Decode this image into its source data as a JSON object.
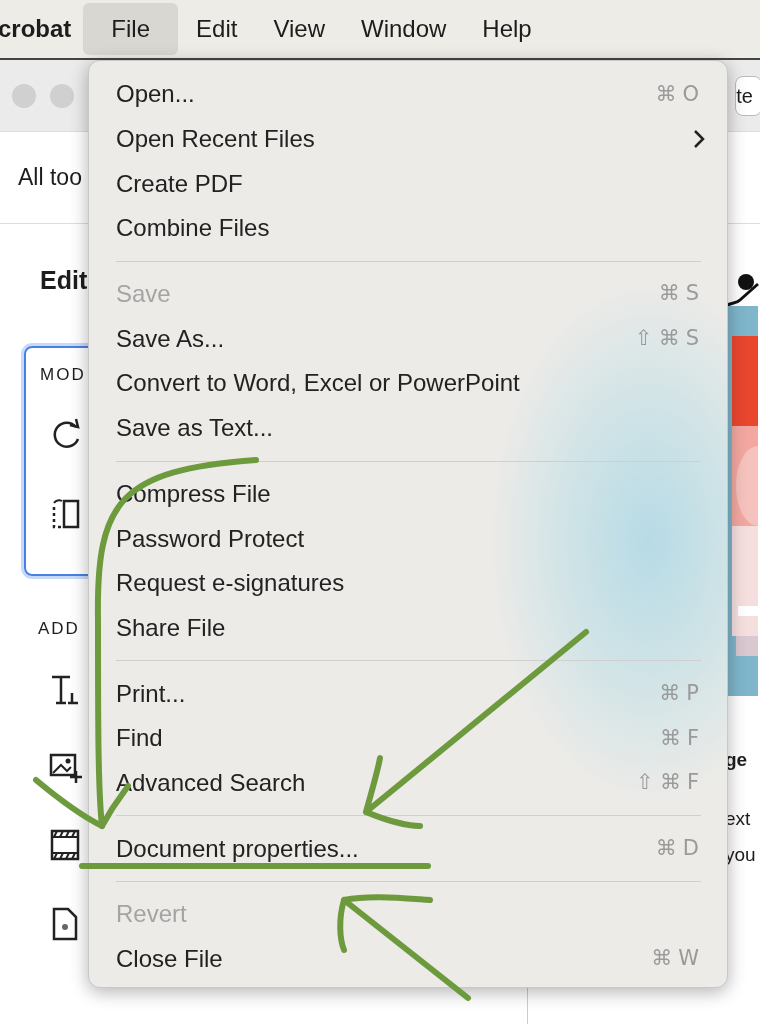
{
  "menu_bar": {
    "app_name": "crobat",
    "items": [
      {
        "label": "File",
        "selected": true
      },
      {
        "label": "Edit",
        "selected": false
      },
      {
        "label": "View",
        "selected": false
      },
      {
        "label": "Window",
        "selected": false
      },
      {
        "label": "Help",
        "selected": false
      }
    ]
  },
  "window": {
    "toolbar_button": "te",
    "tab": "All too",
    "panel_title": "Edit",
    "sections": [
      {
        "title": "MOD",
        "selected": true
      },
      {
        "title": "ADD",
        "selected": false
      }
    ],
    "right_texts": [
      "ge",
      "ext",
      "you"
    ]
  },
  "file_menu": {
    "groups": [
      [
        {
          "label": "Open...",
          "shortcut": "⌘O",
          "disabled": false,
          "submenu": false
        },
        {
          "label": "Open Recent Files",
          "disabled": false,
          "submenu": true
        },
        {
          "label": "Create PDF",
          "disabled": false,
          "submenu": false
        },
        {
          "label": "Combine Files",
          "disabled": false,
          "submenu": false
        }
      ],
      [
        {
          "label": "Save",
          "shortcut": "⌘S",
          "disabled": true,
          "submenu": false
        },
        {
          "label": "Save As...",
          "shortcut": "⇧⌘S",
          "disabled": false,
          "submenu": false
        },
        {
          "label": "Convert to Word, Excel or PowerPoint",
          "disabled": false,
          "submenu": false
        },
        {
          "label": "Save as Text...",
          "disabled": false,
          "submenu": false
        }
      ],
      [
        {
          "label": "Compress File",
          "disabled": false,
          "submenu": false
        },
        {
          "label": "Password Protect",
          "disabled": false,
          "submenu": false
        },
        {
          "label": "Request e-signatures",
          "disabled": false,
          "submenu": false
        },
        {
          "label": "Share File",
          "disabled": false,
          "submenu": false
        }
      ],
      [
        {
          "label": "Print...",
          "shortcut": "⌘P",
          "disabled": false,
          "submenu": false
        },
        {
          "label": "Find",
          "shortcut": "⌘F",
          "disabled": false,
          "submenu": false
        },
        {
          "label": "Advanced Search",
          "shortcut": "⇧⌘F",
          "disabled": false,
          "submenu": false
        }
      ],
      [
        {
          "label": "Document properties...",
          "shortcut": "⌘D",
          "disabled": false,
          "submenu": false
        }
      ],
      [
        {
          "label": "Revert",
          "disabled": true,
          "submenu": false
        },
        {
          "label": "Close File",
          "shortcut": "⌘W",
          "disabled": false,
          "submenu": false
        }
      ]
    ]
  }
}
